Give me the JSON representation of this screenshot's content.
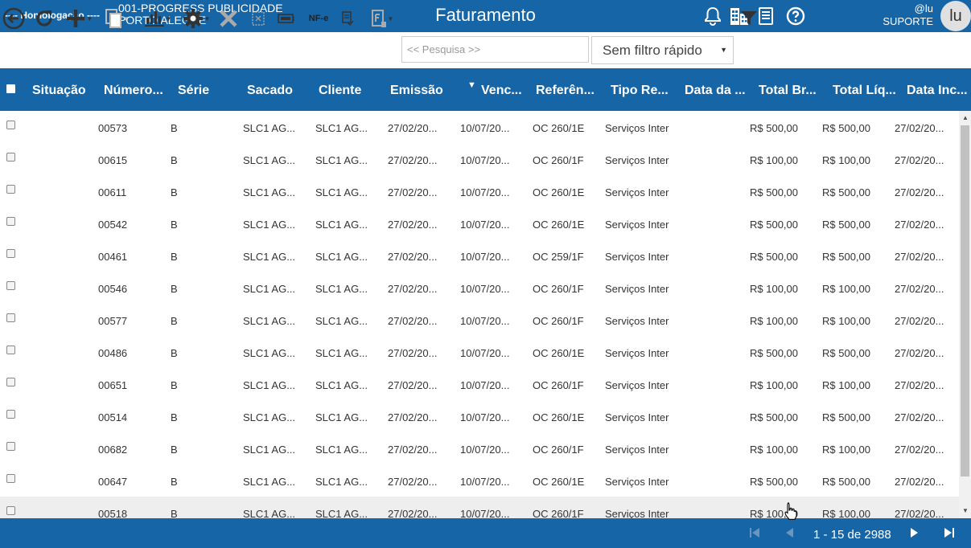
{
  "header": {
    "environment": "---- Homologação ----",
    "company_line1": "001-PROGRESS PUBLICIDADE",
    "company_line2": "PORTO ALEGRE",
    "title": "Faturamento",
    "user_handle": "@lu",
    "user_role": "SUPORTE",
    "avatar_initials": "lu",
    "icons": [
      "bell-icon",
      "building-icon",
      "document-icon",
      "help-icon"
    ]
  },
  "toolbar": {
    "nfe_label": "NF-e",
    "search_placeholder": "<< Pesquisa >>",
    "quick_filter_value": "Sem filtro rápido",
    "icons": [
      "back-icon",
      "refresh-icon",
      "add-icon",
      "copy-icon",
      "chart-icon",
      "settings-icon",
      "delete-icon",
      "cancel-doc-icon",
      "invoice-icon",
      "nfe-icon",
      "print-doc-icon",
      "export-icon",
      "filter-icon"
    ]
  },
  "grid": {
    "sort_column": "Venc...",
    "columns": [
      "Situação",
      "Número...",
      "Série",
      "Sacado",
      "Cliente",
      "Emissão",
      "Venc...",
      "Referên...",
      "Tipo Re...",
      "Data da ...",
      "Total Br...",
      "Total Líq...",
      "Data Inc..."
    ],
    "rows": [
      {
        "numero": "00573",
        "serie": "B",
        "sacado": "SLC1 AG...",
        "cliente": "SLC1 AG...",
        "emissao": "27/02/20...",
        "venc": "10/07/20...",
        "ref": "OC 260/1E",
        "tipo": "Serviços Inter",
        "data": "",
        "bruto": "R$ 500,00",
        "liquido": "R$ 500,00",
        "inc": "27/02/20..."
      },
      {
        "numero": "00615",
        "serie": "B",
        "sacado": "SLC1 AG...",
        "cliente": "SLC1 AG...",
        "emissao": "27/02/20...",
        "venc": "10/07/20...",
        "ref": "OC 260/1F",
        "tipo": "Serviços Inter",
        "data": "",
        "bruto": "R$ 100,00",
        "liquido": "R$ 100,00",
        "inc": "27/02/20..."
      },
      {
        "numero": "00611",
        "serie": "B",
        "sacado": "SLC1 AG...",
        "cliente": "SLC1 AG...",
        "emissao": "27/02/20...",
        "venc": "10/07/20...",
        "ref": "OC 260/1E",
        "tipo": "Serviços Inter",
        "data": "",
        "bruto": "R$ 500,00",
        "liquido": "R$ 500,00",
        "inc": "27/02/20..."
      },
      {
        "numero": "00542",
        "serie": "B",
        "sacado": "SLC1 AG...",
        "cliente": "SLC1 AG...",
        "emissao": "27/02/20...",
        "venc": "10/07/20...",
        "ref": "OC 260/1E",
        "tipo": "Serviços Inter",
        "data": "",
        "bruto": "R$ 500,00",
        "liquido": "R$ 500,00",
        "inc": "27/02/20..."
      },
      {
        "numero": "00461",
        "serie": "B",
        "sacado": "SLC1 AG...",
        "cliente": "SLC1 AG...",
        "emissao": "27/02/20...",
        "venc": "10/07/20...",
        "ref": "OC 259/1F",
        "tipo": "Serviços Inter",
        "data": "",
        "bruto": "R$ 500,00",
        "liquido": "R$ 500,00",
        "inc": "27/02/20..."
      },
      {
        "numero": "00546",
        "serie": "B",
        "sacado": "SLC1 AG...",
        "cliente": "SLC1 AG...",
        "emissao": "27/02/20...",
        "venc": "10/07/20...",
        "ref": "OC 260/1F",
        "tipo": "Serviços Inter",
        "data": "",
        "bruto": "R$ 100,00",
        "liquido": "R$ 100,00",
        "inc": "27/02/20..."
      },
      {
        "numero": "00577",
        "serie": "B",
        "sacado": "SLC1 AG...",
        "cliente": "SLC1 AG...",
        "emissao": "27/02/20...",
        "venc": "10/07/20...",
        "ref": "OC 260/1F",
        "tipo": "Serviços Inter",
        "data": "",
        "bruto": "R$ 100,00",
        "liquido": "R$ 100,00",
        "inc": "27/02/20..."
      },
      {
        "numero": "00486",
        "serie": "B",
        "sacado": "SLC1 AG...",
        "cliente": "SLC1 AG...",
        "emissao": "27/02/20...",
        "venc": "10/07/20...",
        "ref": "OC 260/1E",
        "tipo": "Serviços Inter",
        "data": "",
        "bruto": "R$ 500,00",
        "liquido": "R$ 500,00",
        "inc": "27/02/20..."
      },
      {
        "numero": "00651",
        "serie": "B",
        "sacado": "SLC1 AG...",
        "cliente": "SLC1 AG...",
        "emissao": "27/02/20...",
        "venc": "10/07/20...",
        "ref": "OC 260/1F",
        "tipo": "Serviços Inter",
        "data": "",
        "bruto": "R$ 100,00",
        "liquido": "R$ 100,00",
        "inc": "27/02/20..."
      },
      {
        "numero": "00514",
        "serie": "B",
        "sacado": "SLC1 AG...",
        "cliente": "SLC1 AG...",
        "emissao": "27/02/20...",
        "venc": "10/07/20...",
        "ref": "OC 260/1E",
        "tipo": "Serviços Inter",
        "data": "",
        "bruto": "R$ 500,00",
        "liquido": "R$ 500,00",
        "inc": "27/02/20..."
      },
      {
        "numero": "00682",
        "serie": "B",
        "sacado": "SLC1 AG...",
        "cliente": "SLC1 AG...",
        "emissao": "27/02/20...",
        "venc": "10/07/20...",
        "ref": "OC 260/1F",
        "tipo": "Serviços Inter",
        "data": "",
        "bruto": "R$ 100,00",
        "liquido": "R$ 100,00",
        "inc": "27/02/20..."
      },
      {
        "numero": "00647",
        "serie": "B",
        "sacado": "SLC1 AG...",
        "cliente": "SLC1 AG...",
        "emissao": "27/02/20...",
        "venc": "10/07/20...",
        "ref": "OC 260/1E",
        "tipo": "Serviços Inter",
        "data": "",
        "bruto": "R$ 500,00",
        "liquido": "R$ 500,00",
        "inc": "27/02/20..."
      },
      {
        "numero": "00518",
        "serie": "B",
        "sacado": "SLC1 AG...",
        "cliente": "SLC1 AG...",
        "emissao": "27/02/20...",
        "venc": "10/07/20...",
        "ref": "OC 260/1F",
        "tipo": "Serviços Inter",
        "data": "",
        "bruto": "R$ 100,00",
        "liquido": "R$ 100,00",
        "inc": "27/02/20..."
      }
    ],
    "hover_row_index": 12
  },
  "pager": {
    "info": "1 - 15 de 2988"
  },
  "colors": {
    "brand": "#1565a7",
    "row_hover": "#eeeeee"
  }
}
